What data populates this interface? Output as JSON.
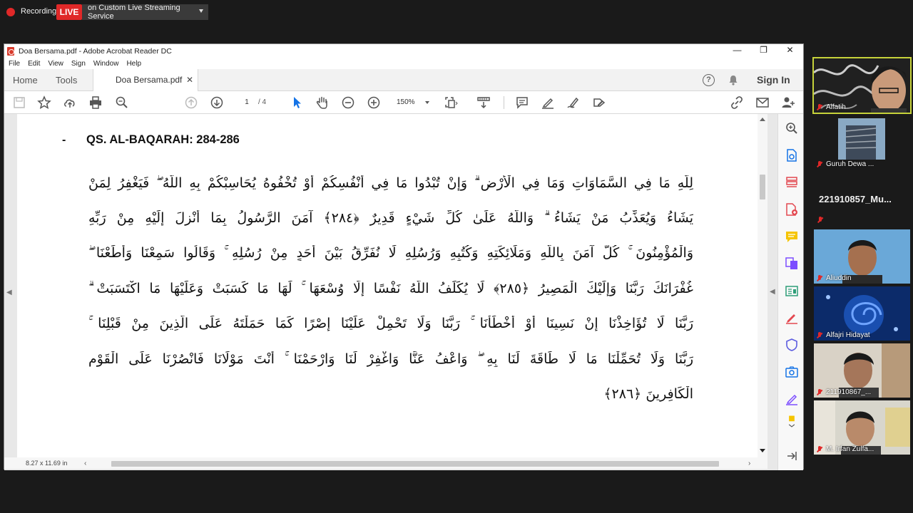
{
  "recording": {
    "label": "Recording",
    "live": "LIVE",
    "service": "on Custom Live Streaming Service"
  },
  "window": {
    "title": "Doa Bersama.pdf - Adobe Acrobat Reader DC",
    "minimize": "—",
    "restore": "❐",
    "close": "✕"
  },
  "menu": [
    "File",
    "Edit",
    "View",
    "Sign",
    "Window",
    "Help"
  ],
  "tabs": {
    "home": "Home",
    "tools": "Tools",
    "doc": "Doa Bersama.pdf",
    "close": "✕"
  },
  "header": {
    "help": "?",
    "signin": "Sign In"
  },
  "toolbar": {
    "page_current": "1",
    "page_total": "/ 4",
    "zoom": "150%"
  },
  "document": {
    "bullet": "-",
    "heading": "QS. AL-BAQARAH: 284-286",
    "lines": [
      "لِلَّهِ مَا فِي السَّمَاوَاتِ وَمَا فِي الْأَرْضِ ۗ وَإِنْ تُبْدُوا مَا فِي أَنْفُسِكُمْ أَوْ تُخْفُوهُ يُحَاسِبْكُمْ بِهِ اللَّهُ ۖ فَيَغْفِرُ لِمَنْ",
      "يَشَاءُ وَيُعَذِّبُ مَنْ يَشَاءُ ۗ وَاللَّهُ عَلَىٰ كُلِّ شَيْءٍ قَدِيرٌ ﴿٢٨٤﴾ آمَنَ الرَّسُولُ بِمَا أُنْزِلَ إِلَيْهِ مِنْ رَبِّهِ",
      "وَالْمُؤْمِنُونَ ۚ كُلٌّ آمَنَ بِاللَّهِ وَمَلَائِكَتِهِ وَكُتُبِهِ وَرُسُلِهِ لَا نُفَرِّقُ بَيْنَ أَحَدٍ مِنْ رُسُلِهِ ۚ وَقَالُوا سَمِعْنَا وَأَطَعْنَا ۖ",
      "غُفْرَانَكَ رَبَّنَا وَإِلَيْكَ الْمَصِيرُ ﴿٢٨٥﴾ لَا يُكَلِّفُ اللَّهُ نَفْسًا إِلَّا وُسْعَهَا ۚ لَهَا مَا كَسَبَتْ وَعَلَيْهَا مَا اكْتَسَبَتْ ۗ",
      "رَبَّنَا لَا تُؤَاخِذْنَا إِنْ نَسِينَا أَوْ أَخْطَأْنَا ۚ رَبَّنَا وَلَا تَحْمِلْ عَلَيْنَا إِصْرًا كَمَا حَمَلْتَهُ عَلَى الَّذِينَ مِنْ قَبْلِنَا ۚ",
      "رَبَّنَا وَلَا تُحَمِّلْنَا مَا لَا طَاقَةَ لَنَا بِهِ ۖ وَاعْفُ عَنَّا وَاغْفِرْ لَنَا وَارْحَمْنَا ۚ أَنْتَ مَوْلَانَا فَانْصُرْنَا عَلَى الْقَوْمِ",
      "الْكَافِرِينَ ﴿٢٨٦﴾"
    ]
  },
  "statusbar": {
    "page_size": "8.27 x 11.69 in"
  },
  "participants": [
    {
      "name": "Alfatih"
    },
    {
      "name": "Guruh Dewa ..."
    },
    {
      "name": "221910857_Mu..."
    },
    {
      "name": "Aliuddin"
    },
    {
      "name": "Alfajri Hidayat"
    },
    {
      "name": "211910867_..."
    },
    {
      "name": "M. Irfan Zulfa..."
    }
  ],
  "colors": {
    "live_red": "#e02828",
    "active_border": "#c6d23a",
    "acrobat_blue": "#1473e6"
  }
}
